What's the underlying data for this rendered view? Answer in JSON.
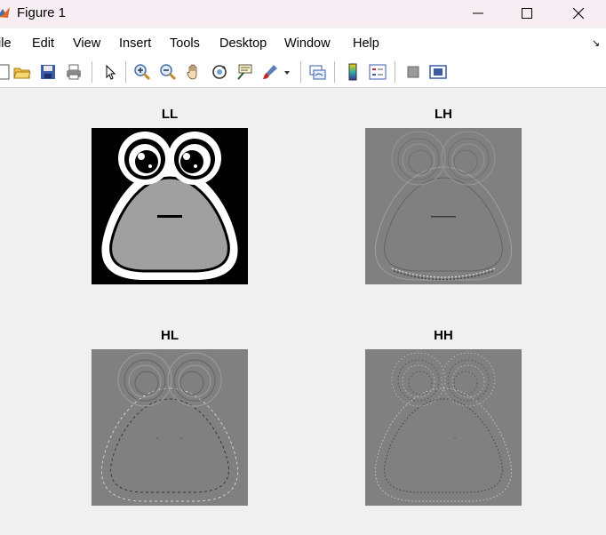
{
  "window": {
    "title": "Figure 1"
  },
  "menu": [
    "ile",
    "Edit",
    "View",
    "Insert",
    "Tools",
    "Desktop",
    "Window",
    "Help"
  ],
  "toolbar_icons": [
    "new-figure-icon",
    "open-file-icon",
    "save-icon",
    "print-icon",
    "select-arrow-icon",
    "zoom-in-icon",
    "zoom-out-icon",
    "pan-hand-icon",
    "rotate-3d-icon",
    "data-tips-icon",
    "brush-icon",
    "link-plot-icon",
    "colorbar-icon",
    "legend-icon",
    "hide-plot-tools-icon",
    "show-plot-tools-icon"
  ],
  "axes": [
    {
      "title": "LL"
    },
    {
      "title": "LH"
    },
    {
      "title": "HL"
    },
    {
      "title": "HH"
    }
  ],
  "colors": {
    "background": "#f0f0f0",
    "detail_gray": "#808080",
    "approx_gray": "#a0a0a0"
  }
}
